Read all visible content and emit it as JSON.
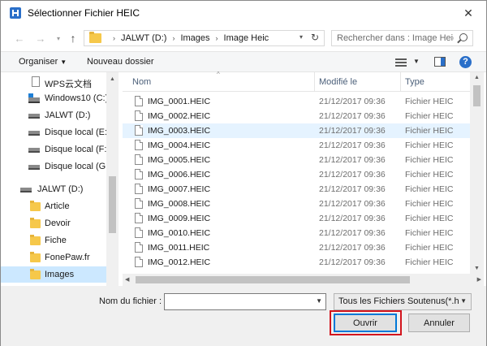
{
  "window": {
    "title": "Sélectionner Fichier HEIC",
    "close_symbol": "✕"
  },
  "address_bar": {
    "breadcrumbs": [
      "JALWT (D:)",
      "Images",
      "Image Heic"
    ],
    "separator": "›",
    "search_placeholder": "Rechercher dans : Image Heic"
  },
  "toolbar": {
    "organise_label": "Organiser",
    "new_folder_label": "Nouveau dossier",
    "help_label": "?"
  },
  "nav_pane": {
    "items": [
      {
        "label": "WPS云文档",
        "icon": "document-icon"
      },
      {
        "label": "Windows10 (C:)",
        "icon": "windows-drive-icon"
      },
      {
        "label": "JALWT (D:)",
        "icon": "drive-icon"
      },
      {
        "label": "Disque local (E:)",
        "icon": "drive-icon"
      },
      {
        "label": "Disque local (F:)",
        "icon": "drive-icon"
      },
      {
        "label": "Disque local (G:)",
        "icon": "drive-icon"
      },
      {
        "label": "JALWT (D:)",
        "icon": "drive-icon"
      },
      {
        "label": "Article",
        "icon": "folder-icon"
      },
      {
        "label": "Devoir",
        "icon": "folder-icon"
      },
      {
        "label": "Fiche",
        "icon": "folder-icon"
      },
      {
        "label": "FonePaw.fr",
        "icon": "folder-icon"
      },
      {
        "label": "Images",
        "icon": "folder-icon",
        "selected": true
      }
    ]
  },
  "file_list": {
    "columns": {
      "name": "Nom",
      "modified": "Modifié le",
      "type": "Type"
    },
    "rows": [
      {
        "name": "IMG_0001.HEIC",
        "modified": "21/12/2017 09:36",
        "type": "Fichier HEIC"
      },
      {
        "name": "IMG_0002.HEIC",
        "modified": "21/12/2017 09:36",
        "type": "Fichier HEIC"
      },
      {
        "name": "IMG_0003.HEIC",
        "modified": "21/12/2017 09:36",
        "type": "Fichier HEIC",
        "hover": true
      },
      {
        "name": "IMG_0004.HEIC",
        "modified": "21/12/2017 09:36",
        "type": "Fichier HEIC"
      },
      {
        "name": "IMG_0005.HEIC",
        "modified": "21/12/2017 09:36",
        "type": "Fichier HEIC"
      },
      {
        "name": "IMG_0006.HEIC",
        "modified": "21/12/2017 09:36",
        "type": "Fichier HEIC"
      },
      {
        "name": "IMG_0007.HEIC",
        "modified": "21/12/2017 09:36",
        "type": "Fichier HEIC"
      },
      {
        "name": "IMG_0008.HEIC",
        "modified": "21/12/2017 09:36",
        "type": "Fichier HEIC"
      },
      {
        "name": "IMG_0009.HEIC",
        "modified": "21/12/2017 09:36",
        "type": "Fichier HEIC"
      },
      {
        "name": "IMG_0010.HEIC",
        "modified": "21/12/2017 09:36",
        "type": "Fichier HEIC"
      },
      {
        "name": "IMG_0011.HEIC",
        "modified": "21/12/2017 09:36",
        "type": "Fichier HEIC"
      },
      {
        "name": "IMG_0012.HEIC",
        "modified": "21/12/2017 09:36",
        "type": "Fichier HEIC"
      }
    ]
  },
  "footer": {
    "filename_label": "Nom du fichier :",
    "filename_value": "",
    "filter_value": "Tous les Fichiers Soutenus(*.hei",
    "open_label": "Ouvrir",
    "cancel_label": "Annuler"
  },
  "colors": {
    "accent": "#0078d7",
    "selection": "#cce8ff",
    "hover": "#e5f3ff",
    "annotation_box": "#d3141d",
    "folder": "#f6c84a"
  }
}
